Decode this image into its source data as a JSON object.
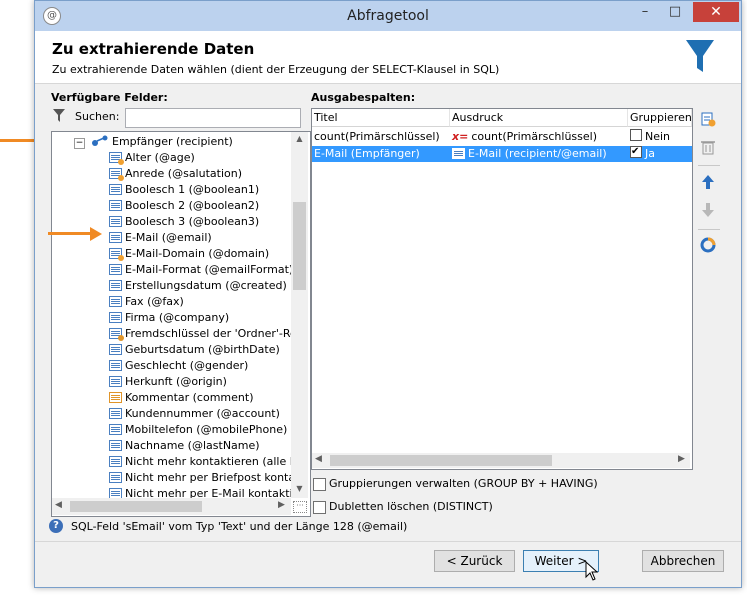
{
  "window": {
    "title": "Abfragetool",
    "app_icon": "app-logo-icon",
    "controls": {
      "minimize": "–",
      "maximize": "□",
      "close": "✕"
    }
  },
  "header": {
    "title": "Zu extrahierende Daten",
    "subtitle": "Zu extrahierende Daten wählen (dient der Erzeugung der SELECT-Klausel in SQL)",
    "icon": "filter-funnel-icon",
    "icon_color": "#1f6fb2"
  },
  "available_fields": {
    "label": "Verfügbare Felder:",
    "search_label": "Suchen:",
    "search_value": "",
    "root": {
      "toggle": "−",
      "label": "Empfänger (recipient)"
    },
    "items": [
      {
        "label": "Alter (@age)",
        "icon": "computed-field-icon"
      },
      {
        "label": "Anrede (@salutation)",
        "icon": "computed-field-icon"
      },
      {
        "label": "Boolesch 1 (@boolean1)",
        "icon": "field-icon"
      },
      {
        "label": "Boolesch 2 (@boolean2)",
        "icon": "field-icon"
      },
      {
        "label": "Boolesch 3 (@boolean3)",
        "icon": "field-icon"
      },
      {
        "label": "E-Mail (@email)",
        "icon": "field-icon"
      },
      {
        "label": "E-Mail-Domain (@domain)",
        "icon": "computed-field-icon"
      },
      {
        "label": "E-Mail-Format (@emailFormat)",
        "icon": "field-icon"
      },
      {
        "label": "Erstellungsdatum (@created)",
        "icon": "field-icon"
      },
      {
        "label": "Fax (@fax)",
        "icon": "field-icon"
      },
      {
        "label": "Firma (@company)",
        "icon": "field-icon"
      },
      {
        "label": "Fremdschlüssel der 'Ordner'-Re",
        "icon": "link-field-icon"
      },
      {
        "label": "Geburtsdatum (@birthDate)",
        "icon": "field-icon"
      },
      {
        "label": "Geschlecht (@gender)",
        "icon": "field-icon"
      },
      {
        "label": "Herkunft (@origin)",
        "icon": "field-icon"
      },
      {
        "label": "Kommentar (comment)",
        "icon": "memo-field-icon"
      },
      {
        "label": "Kundennummer (@account)",
        "icon": "field-icon"
      },
      {
        "label": "Mobiltelefon (@mobilePhone)",
        "icon": "field-icon"
      },
      {
        "label": "Nachname (@lastName)",
        "icon": "field-icon"
      },
      {
        "label": "Nicht mehr kontaktieren (alle K",
        "icon": "field-icon"
      },
      {
        "label": "Nicht mehr per Briefpost konta",
        "icon": "field-icon"
      },
      {
        "label": "Nicht mehr per E-Mail kontakti",
        "icon": "field-icon"
      }
    ]
  },
  "output_columns": {
    "label": "Ausgabespalten:",
    "headers": [
      "Titel",
      "Ausdruck",
      "Gruppieren"
    ],
    "rows": [
      {
        "title": "count(Primärschlüssel)",
        "expression": "count(Primärschlüssel)",
        "expr_icon": "x=",
        "group_checked": false,
        "group_label": "Nein",
        "selected": false
      },
      {
        "title": "E-Mail (Empfänger)",
        "expression": "E-Mail (recipient/@email)",
        "expr_icon": "field-icon",
        "group_checked": true,
        "group_label": "Ja",
        "selected": true
      }
    ]
  },
  "side_toolbar": [
    "add-icon",
    "delete-icon",
    "move-up-icon",
    "move-down-icon",
    "distribution-icon"
  ],
  "options": {
    "group_by": {
      "label": "Gruppierungen verwalten (GROUP BY + HAVING)",
      "checked": false
    },
    "distinct": {
      "label": "Dubletten löschen (DISTINCT)",
      "checked": false
    }
  },
  "status": {
    "text": "SQL-Feld 'sEmail' vom Typ 'Text' und der Länge 128 (@email)"
  },
  "buttons": {
    "back": "< Zurück",
    "next": "Weiter >",
    "cancel": "Abbrechen"
  },
  "colors": {
    "accent": "#3399ff",
    "annotation_arrow": "#f08a24",
    "close": "#c7413a"
  }
}
